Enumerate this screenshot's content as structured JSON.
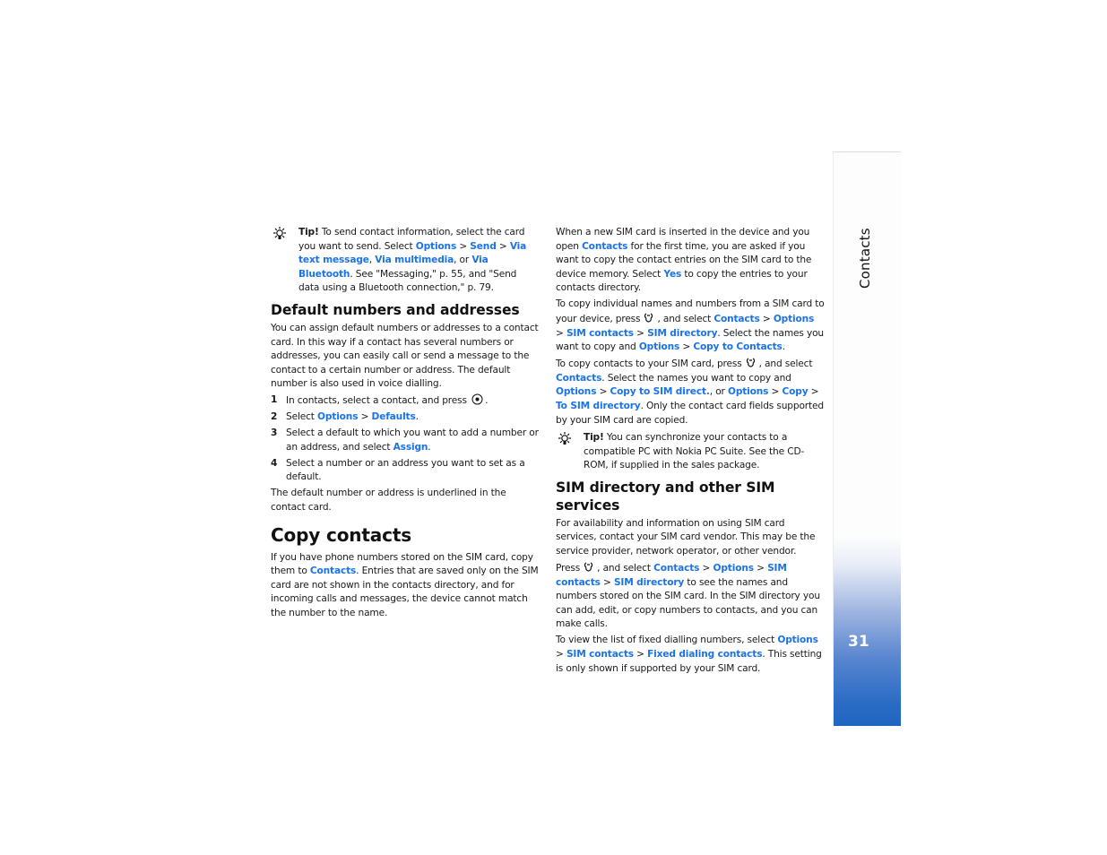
{
  "sidebar": {
    "section_title": "Contacts",
    "page_number": "31",
    "colors": {
      "gradient_top": "#fdfdfd",
      "gradient_bottom": "#1f66c1"
    }
  },
  "link_color": "#1a73e8",
  "left_column": {
    "tip1": {
      "icon": "lightbulb-icon",
      "label": "Tip!",
      "t1": " To send contact information, select the card you want to send. Select ",
      "l1": "Options",
      "t2": " > ",
      "l2": "Send",
      "t3": " > ",
      "l3": "Via text message",
      "t4": ", ",
      "l4": "Via multimedia",
      "t5": ", or ",
      "l5": "Via Bluetooth",
      "t6": ". See \"Messaging,\" p. 55, and \"Send data using a Bluetooth connection,\" p. 79."
    },
    "default_heading": "Default numbers and addresses",
    "default_intro": "You can assign default numbers or addresses to a contact card. In this way if a contact has several numbers or addresses, you can easily call or send a message to the contact to a certain number or address. The default number is also used in voice dialling.",
    "steps": [
      {
        "num": "1",
        "t1": "In contacts, select a contact, and press",
        "icon": "scroll-key-icon",
        "t2": "."
      },
      {
        "num": "2",
        "t1": "Select ",
        "l1": "Options",
        "t2": " > ",
        "l2": "Defaults",
        "t3": "."
      },
      {
        "num": "3",
        "t1": "Select a default to which you want to add a number or an address, and select ",
        "l1": "Assign",
        "t2": "."
      },
      {
        "num": "4",
        "t1": "Select a number or an address you want to set as a default."
      }
    ],
    "default_outro": "The default number or address is underlined in the contact card.",
    "copy_heading": "Copy contacts",
    "copy_p": {
      "t1": "If you have phone numbers stored on the SIM card, copy them to ",
      "l1": "Contacts",
      "t2": ". Entries that are saved only on the SIM card are not shown in the contacts directory, and for incoming calls and messages, the device cannot match the number to the name."
    }
  },
  "right_column": {
    "p1": {
      "t1": "When a new SIM card is inserted in the device and you open ",
      "l1": "Contacts",
      "t2": " for the first time, you are asked if you want to copy the contact entries on the SIM card to the device memory. Select ",
      "l2": "Yes",
      "t3": " to copy the entries to your contacts directory."
    },
    "p2": {
      "t1": "To copy individual names and numbers from a SIM card to your device, press",
      "icon": "menu-key-icon",
      "t2": ", and select ",
      "l1": "Contacts",
      "t3": " > ",
      "l2": "Options",
      "t4": " > ",
      "l3": "SIM contacts",
      "t5": " > ",
      "l4": "SIM directory",
      "t6": ". Select the names you want to copy and ",
      "l5": "Options",
      "t7": " > ",
      "l6": "Copy to Contacts",
      "t8": "."
    },
    "p3": {
      "t1": "To copy contacts to your SIM card, press",
      "icon": "menu-key-icon",
      "t2": ", and select ",
      "l1": "Contacts",
      "t3": ". Select the names you want to copy and ",
      "l2": "Options",
      "t4": " > ",
      "l3": "Copy to SIM direct.",
      "t5": ", or ",
      "l4": "Options",
      "t6": " > ",
      "l5": "Copy",
      "t7": " > ",
      "l6": "To SIM directory",
      "t8": ". Only the contact card fields supported by your SIM card are copied."
    },
    "tip2": {
      "icon": "lightbulb-icon",
      "label": "Tip!",
      "t1": " You can synchronize your contacts to a compatible PC with Nokia PC Suite. See the CD-ROM, if supplied in the sales package."
    },
    "sim_heading": "SIM directory and other SIM services",
    "p4": "For availability and information on using SIM card services, contact your SIM card vendor. This may be the service provider, network operator, or other vendor.",
    "p5": {
      "t1": "Press",
      "icon": "menu-key-icon",
      "t2": ", and select ",
      "l1": "Contacts",
      "t3": " > ",
      "l2": "Options",
      "t4": " > ",
      "l3": "SIM contacts",
      "t5": " > ",
      "l4": "SIM directory",
      "t6": " to see the names and numbers stored on the SIM card. In the SIM directory you can add, edit, or copy numbers to contacts, and you can make calls."
    },
    "p6": {
      "t1": "To view the list of fixed dialling numbers, select ",
      "l1": "Options",
      "t2": " > ",
      "l2": "SIM contacts",
      "t3": " > ",
      "l3": "Fixed dialing contacts",
      "t4": ". This setting is only shown if supported by your SIM card."
    }
  }
}
